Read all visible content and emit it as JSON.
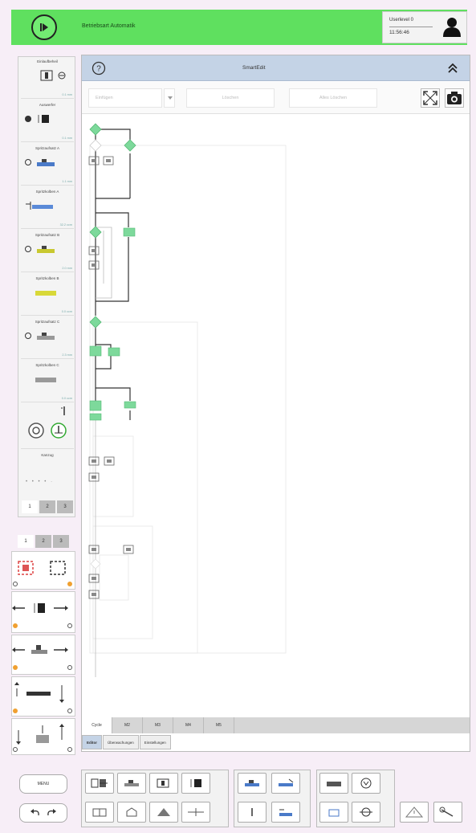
{
  "topbar": {
    "mode": "Betriebsart Automatik",
    "user_level": "Userlevel 0",
    "time": "11:56:46"
  },
  "smartedit": {
    "title": "SmartEdit",
    "insert_placeholder": "Einfügen",
    "delete_label": "Löschen",
    "delete_all_label": "Alles Löschen"
  },
  "left_sidebar": {
    "sections": [
      {
        "title": "Einlaufbeheil",
        "value": "0.1 mm"
      },
      {
        "title": "Auswerfer",
        "value": "0.1 mm"
      },
      {
        "title": "Spritzaufsatz A",
        "value": "1.1 mm"
      },
      {
        "title": "Spritzkolben A",
        "value": "32.2 ccm"
      },
      {
        "title": "Spritzaufsatz B",
        "value": "2.0 mm"
      },
      {
        "title": "Spritzkolben B",
        "value": "0.0 ccm"
      },
      {
        "title": "Spritzaufsatz C",
        "value": "2.3 mm"
      },
      {
        "title": "Spritzkolben C",
        "value": "0.0 ccm"
      }
    ],
    "heizung_label": "Kanzug",
    "tabs": [
      "1",
      "2",
      "3"
    ]
  },
  "left_bottom": {
    "tabs": [
      "1",
      "2",
      "3"
    ]
  },
  "cycle_tabs": [
    "Cycle",
    "M2",
    "M3",
    "M4",
    "M5"
  ],
  "sub_tabs": [
    "Editor",
    "Überwachungen",
    "Einstellungen"
  ],
  "bottom": {
    "menu_label": "MENU"
  },
  "colors": {
    "topbar_green": "#5fe05f",
    "header_blue": "#c4d3e6",
    "node_green": "#7dd99b",
    "panel_bg": "#f4f4f4"
  }
}
